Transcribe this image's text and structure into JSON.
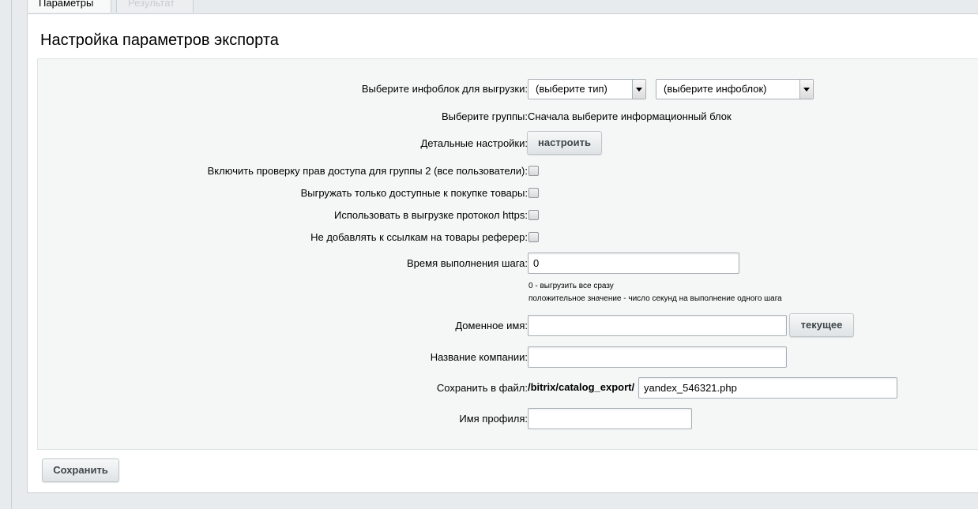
{
  "tabs": {
    "params_label": "Параметры",
    "result_label": "Результат"
  },
  "page_title": "Настройка параметров экспорта",
  "form": {
    "iblock_label": "Выберите инфоблок для выгрузки:",
    "type_select_value": "(выберите тип)",
    "iblock_select_value": "(выберите инфоблок)",
    "groups_label": "Выберите группы:",
    "groups_value": "Сначала выберите информационный блок",
    "detail_label": "Детальные настройки:",
    "detail_button": "настроить",
    "checkbox_access_label": "Включить проверку прав доступа для группы 2 (все пользователи):",
    "checkbox_available_label": "Выгружать только доступные к покупке товары:",
    "checkbox_https_label": "Использовать в выгрузке протокол https:",
    "checkbox_referer_label": "Не добавлять к ссылкам на товары реферер:",
    "step_time_label": "Время выполнения шага:",
    "step_time_value": "0",
    "step_hint_1": "0 - выгрузить все сразу",
    "step_hint_2": "положительное значение - число секунд на выполнение одного шага",
    "domain_label": "Доменное имя:",
    "domain_value": "",
    "domain_button": "текущее",
    "company_label": "Название компании:",
    "company_value": "",
    "file_label": "Сохранить в файл:",
    "file_prefix": "/bitrix/catalog_export/",
    "file_value": "yandex_546321.php",
    "profile_label": "Имя профиля:",
    "profile_value": ""
  },
  "save_button": "Сохранить"
}
